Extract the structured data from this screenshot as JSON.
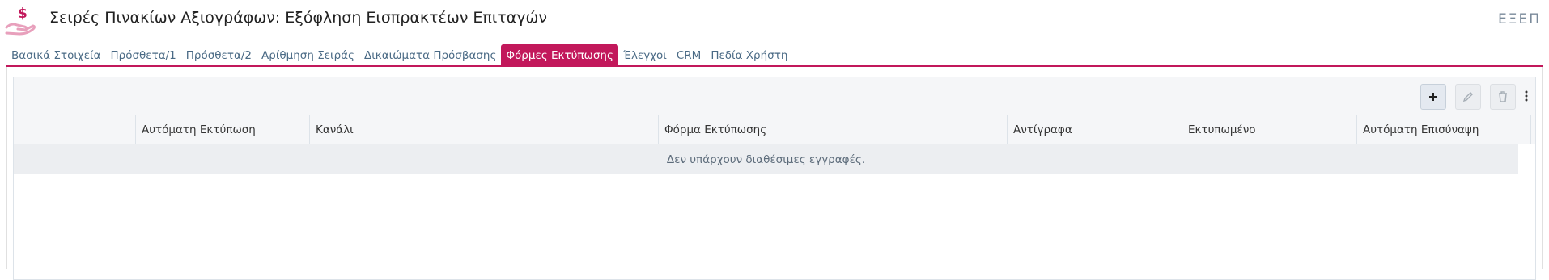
{
  "header": {
    "title": "Σειρές Πινακίων Αξιογράφων: Εξόφληση Εισπρακτέων Επιταγών",
    "code": "ΕΞΕΠ",
    "icon": "money-hand-icon",
    "accent_color": "#c2185b"
  },
  "tabs": [
    {
      "label": "Βασικά Στοιχεία",
      "active": false
    },
    {
      "label": "Πρόσθετα/1",
      "active": false
    },
    {
      "label": "Πρόσθετα/2",
      "active": false
    },
    {
      "label": "Αρίθμηση Σειράς",
      "active": false
    },
    {
      "label": "Δικαιώματα Πρόσβασης",
      "active": false
    },
    {
      "label": "Φόρμες Εκτύπωσης",
      "active": true
    },
    {
      "label": "Έλεγχοι",
      "active": false
    },
    {
      "label": "CRM",
      "active": false
    },
    {
      "label": "Πεδία Χρήστη",
      "active": false
    }
  ],
  "toolbar": {
    "add_icon": "plus-icon",
    "edit_icon": "pencil-icon",
    "delete_icon": "trash-icon",
    "more_icon": "kebab-menu-icon"
  },
  "table": {
    "columns": [
      "",
      "",
      "Αυτόματη Εκτύπωση",
      "Κανάλι",
      "Φόρμα Εκτύπωσης",
      "Αντίγραφα",
      "Εκτυπωμένο",
      "Αυτόματη Επισύναψη"
    ],
    "empty_message": "Δεν υπάρχουν διαθέσιμες εγγραφές."
  }
}
